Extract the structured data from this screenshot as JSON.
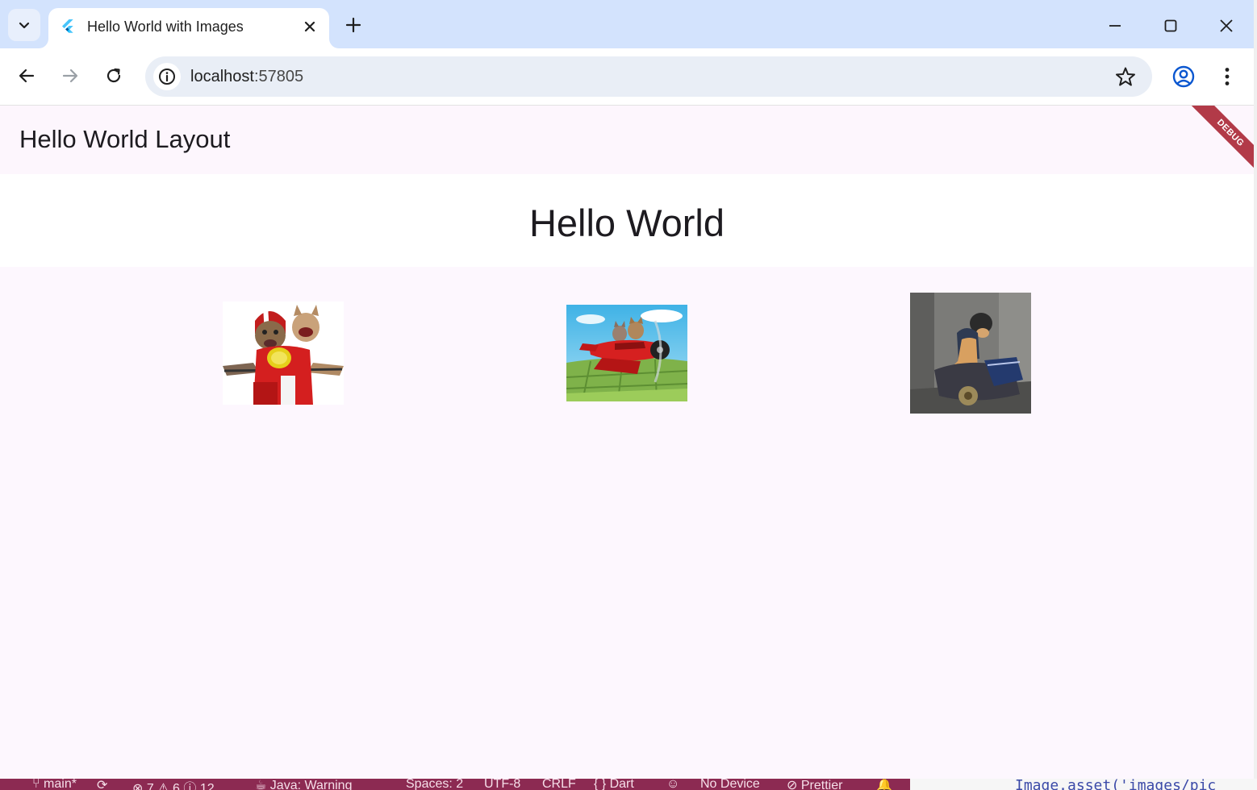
{
  "browser": {
    "tab": {
      "title": "Hello World with Images",
      "favicon": "flutter-icon"
    },
    "url": {
      "host": "localhost",
      "port": ":57805"
    },
    "icons": {
      "tab_search": "chevron-down-icon",
      "close_tab": "close-icon",
      "new_tab": "plus-icon",
      "minimize": "minimize-icon",
      "maximize": "maximize-icon",
      "close_window": "close-icon",
      "back": "arrow-left-icon",
      "forward": "arrow-right-icon",
      "reload": "reload-icon",
      "site_info": "info-icon",
      "bookmark": "star-icon",
      "profile": "profile-icon",
      "menu": "more-vertical-icon"
    }
  },
  "app": {
    "appbar_title": "Hello World Layout",
    "heading": "Hello World",
    "debug_banner": "DEBUG",
    "images": [
      {
        "name": "cats-on-scooter-image"
      },
      {
        "name": "cats-in-airplane-image"
      },
      {
        "name": "cat-on-motorcycle-image"
      }
    ]
  },
  "statusbar": {
    "branch": "main*",
    "errors": "7",
    "warnings": "6",
    "infos": "12",
    "java": "Java: Warning",
    "spaces": "Spaces: 2",
    "encoding": "UTF-8",
    "eol": "CRLF",
    "language": "{ } Dart",
    "device": "No Device",
    "prettier": "Prettier"
  },
  "editor": {
    "code_fragment": "Image.asset('images/pic"
  },
  "colors": {
    "tabstrip": "#d3e3fd",
    "app_background": "#fdf7fe",
    "debug_ribbon": "#b23a48",
    "statusbar": "#8c2a52"
  }
}
